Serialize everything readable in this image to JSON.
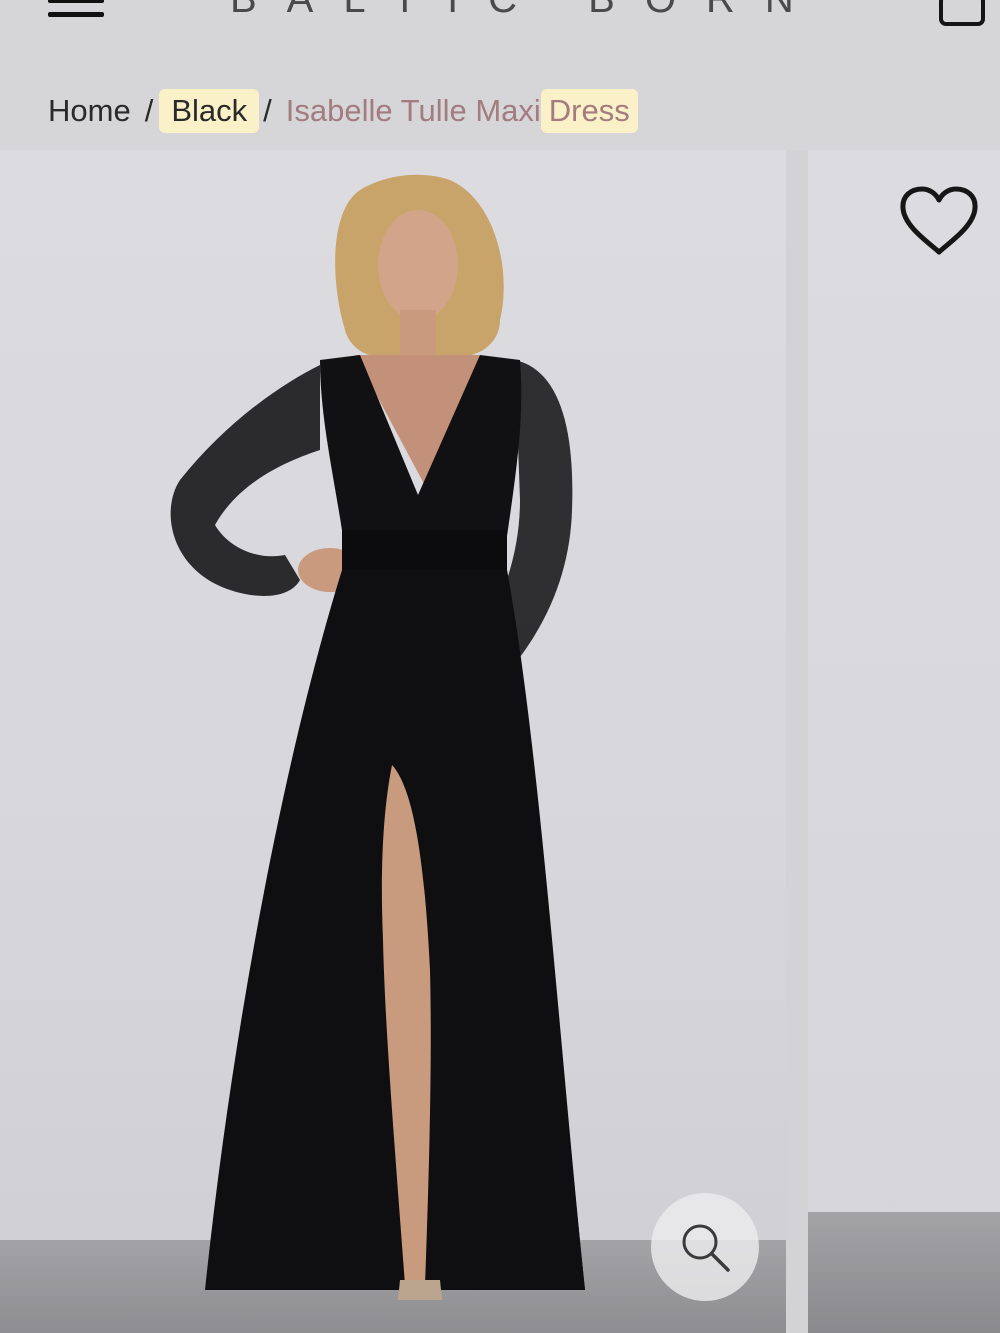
{
  "header": {
    "menu_icon": "hamburger-menu-icon",
    "logo_text": "BALTIC BORN",
    "cart_icon": "shopping-bag-icon"
  },
  "breadcrumb": {
    "home": "Home",
    "separator": "/",
    "category": "Black",
    "product_name_part": "Isabelle Tulle Maxi",
    "product_name_highlight": "Dress"
  },
  "gallery": {
    "main_image_description": "model-in-black-tulle-maxi-dress",
    "wishlist_icon": "heart-icon",
    "zoom_icon": "magnifier-icon"
  },
  "colors": {
    "background": "#d6d6d9",
    "highlight": "#fbf1c8",
    "product_name": "#a27c7e",
    "text": "#2a2a2a"
  }
}
